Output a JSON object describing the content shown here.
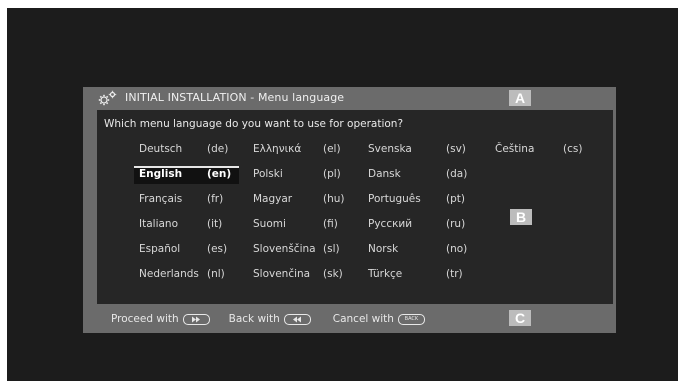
{
  "dialog": {
    "title": "INITIAL INSTALLATION - Menu language",
    "question": "Which menu language do you want to use for operation?",
    "tags": {
      "a": "A",
      "b": "B",
      "c": "C"
    }
  },
  "languages": [
    {
      "name": "Deutsch",
      "code": "(de)"
    },
    {
      "name": "English",
      "code": "(en)",
      "selected": true
    },
    {
      "name": "Français",
      "code": "(fr)"
    },
    {
      "name": "Italiano",
      "code": "(it)"
    },
    {
      "name": "Español",
      "code": "(es)"
    },
    {
      "name": "Nederlands",
      "code": "(nl)"
    },
    {
      "name": "Ελληνικά",
      "code": "(el)"
    },
    {
      "name": "Polski",
      "code": "(pl)"
    },
    {
      "name": "Magyar",
      "code": "(hu)"
    },
    {
      "name": "Suomi",
      "code": "(fi)"
    },
    {
      "name": "Slovenščina",
      "code": "(sl)"
    },
    {
      "name": "Slovenčina",
      "code": "(sk)"
    },
    {
      "name": "Svenska",
      "code": "(sv)"
    },
    {
      "name": "Dansk",
      "code": "(da)"
    },
    {
      "name": "Português",
      "code": "(pt)"
    },
    {
      "name": "Русский",
      "code": "(ru)"
    },
    {
      "name": "Norsk",
      "code": "(no)"
    },
    {
      "name": "Türkçe",
      "code": "(tr)"
    },
    {
      "name": "Čeština",
      "code": "(cs)"
    }
  ],
  "footer": {
    "proceed_label": "Proceed with",
    "proceed_icon": "fast-forward-icon",
    "back_label": "Back with",
    "back_icon": "rewind-icon",
    "cancel_label": "Cancel with",
    "cancel_icon_text": "BACK"
  },
  "colors": {
    "screen_bg": "#1c1c1c",
    "dialog_frame": "#6b6b6b",
    "content_bg": "#262626",
    "tag_bg": "#bcbcbc"
  }
}
